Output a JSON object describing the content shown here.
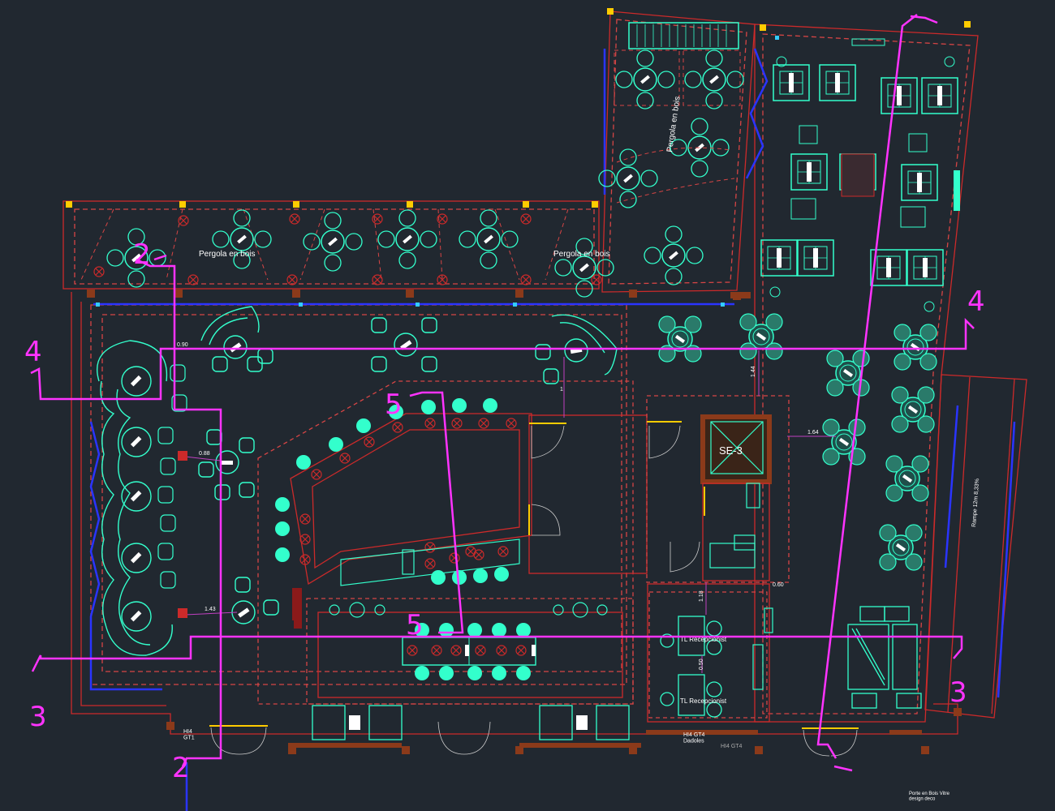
{
  "labels": {
    "pergola_left": "Pergola en bois",
    "pergola_right": "Pergola en bois",
    "pergola_top": "Pergola en bois",
    "se3": "SE-3",
    "reception_1": "TL Recepcionist",
    "reception_2": "TL Recepcionist",
    "ramp": "Rampe 12m 8,33%",
    "door_left": "HI4\nGT1",
    "door_mid": "HI4 GT4\nDadoles",
    "door_mid_tag": "HI4 GT4",
    "note_right": "Porte en Bois Vitre\ndesign deco"
  },
  "dimensions": {
    "d_090": "0.90",
    "d_088": "0.88",
    "d_143": "1.43",
    "d_144": "1.44",
    "d_164": "1.64",
    "d_060": "0.60",
    "d_118": "1.18",
    "d_050": "0.50",
    "d_1": "1"
  },
  "section_marks": {
    "s2_top": "2",
    "s2_bottom": "2",
    "s3_left": "3",
    "s3_right": "3",
    "s4_left": "4",
    "s4_right": "4",
    "s5_top": "5",
    "s5_mid": "5"
  },
  "colors": {
    "background": "#212830",
    "wall_red": "#cc2a2a",
    "dashed_red": "#d64545",
    "furniture_cyan": "#33ffcc",
    "section_magenta": "#ff33ff",
    "column_brown": "#8b3a1a",
    "glazing_blue": "#2a34ff",
    "door_yellow": "#ffcc00"
  }
}
